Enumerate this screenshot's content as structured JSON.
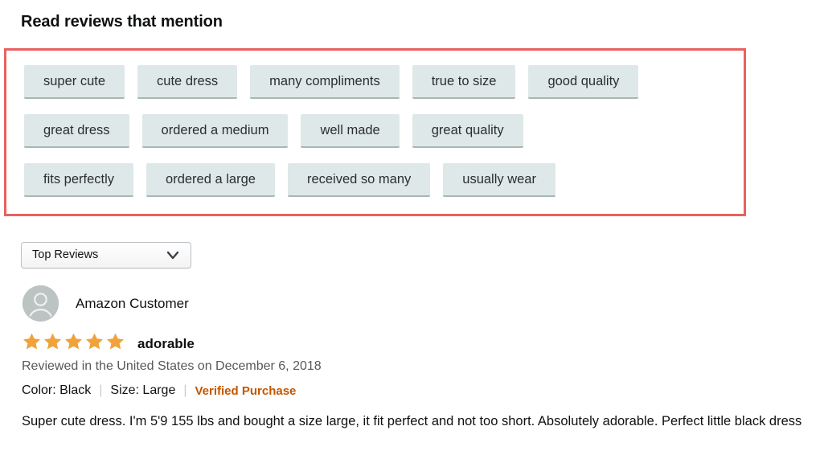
{
  "heading": "Read reviews that mention",
  "tag_rows": [
    [
      {
        "label": "super cute"
      },
      {
        "label": "cute dress"
      },
      {
        "label": "many compliments"
      },
      {
        "label": "true to size"
      },
      {
        "label": "good quality"
      }
    ],
    [
      {
        "label": "great dress"
      },
      {
        "label": "ordered a medium"
      },
      {
        "label": "well made"
      },
      {
        "label": "great quality"
      }
    ],
    [
      {
        "label": "fits perfectly"
      },
      {
        "label": "ordered a large"
      },
      {
        "label": "received so many"
      },
      {
        "label": "usually wear"
      }
    ]
  ],
  "sort": {
    "selected": "Top Reviews",
    "icon": "chevron-down-icon"
  },
  "review": {
    "avatar_icon": "user-avatar-icon",
    "author": "Amazon Customer",
    "rating": 5,
    "rating_max": 5,
    "title": "adorable",
    "date_line": "Reviewed in the United States on December 6, 2018",
    "color_attr": "Color: Black",
    "size_attr": "Size: Large",
    "verified_badge": "Verified Purchase",
    "body": "Super cute dress. I'm 5'9 155 lbs and bought a size large, it fit perfect and not too short. Absolutely adorable. Perfect little black dress"
  },
  "colors": {
    "highlight_border": "#e8615f",
    "tag_bg": "#dfe8e8",
    "tag_underline": "#a9b6b6",
    "star": "#f0a33c",
    "verified": "#c45500",
    "muted_text": "#565959"
  }
}
